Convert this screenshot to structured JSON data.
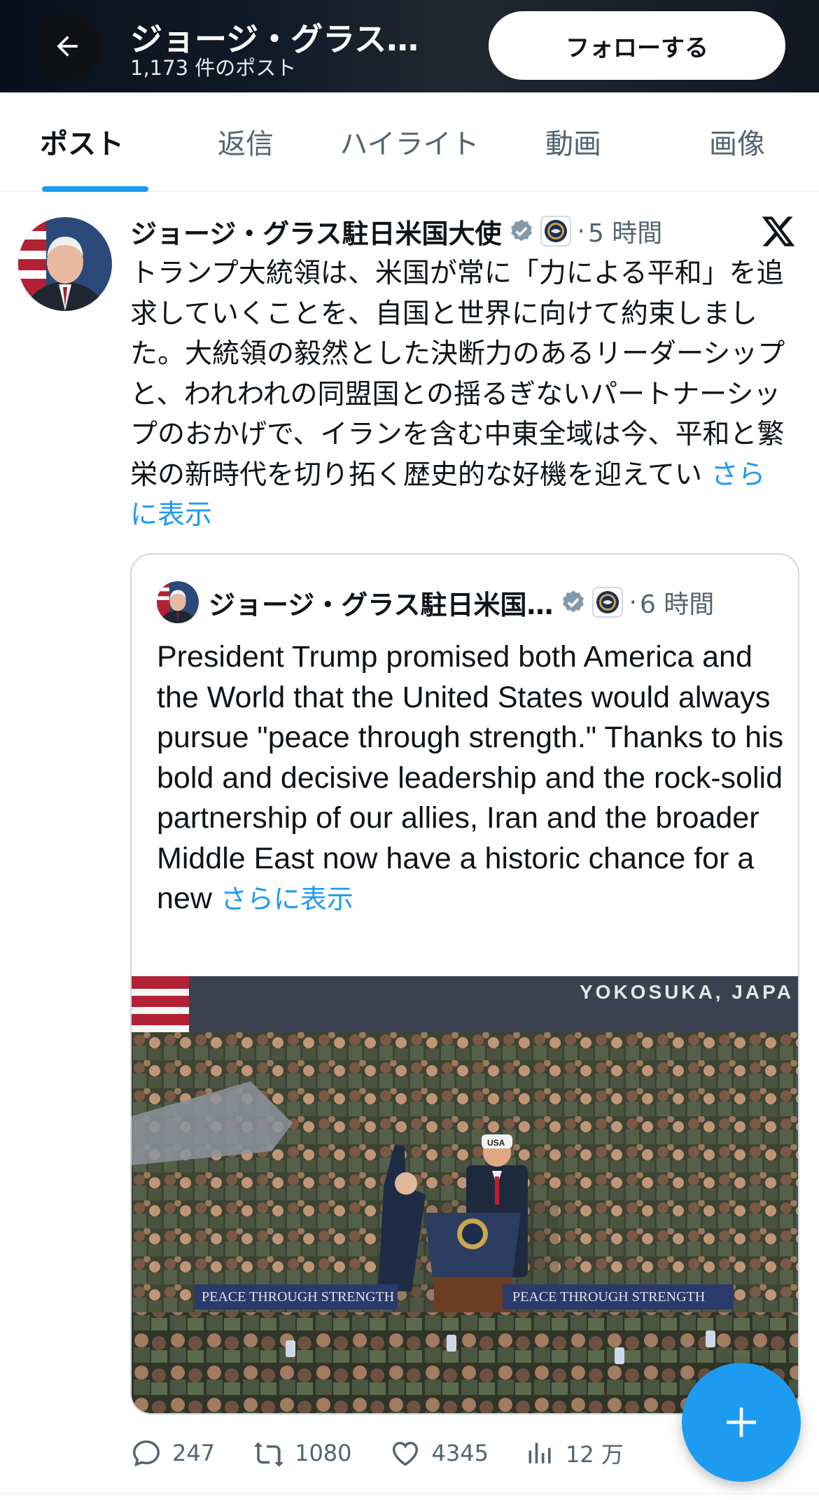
{
  "header": {
    "title": "ジョージ・グラス…",
    "post_count": "1,173 件のポスト",
    "follow_label": "フォローする"
  },
  "tabs": [
    {
      "label": "ポスト",
      "active": true
    },
    {
      "label": "返信",
      "active": false
    },
    {
      "label": "ハイライト",
      "active": false
    },
    {
      "label": "動画",
      "active": false
    },
    {
      "label": "画像",
      "active": false
    }
  ],
  "post": {
    "author_name": "ジョージ・グラス駐日米国大使",
    "separator": "·",
    "time": "5 時間",
    "text": "トランプ大統領は、米国が常に「力による平和」を追求していくことを、自国と世界に向けて約束しました。大統領の毅然とした決断力のあるリーダーシップと、われわれの同盟国との揺るぎないパートナーシップのおかげで、イランを含む中東全域は今、平和と繁栄の新時代を切り拓く歴史的な好機を迎えてい ",
    "show_more": "さらに表示"
  },
  "quote": {
    "author_name": "ジョージ・グラス駐日米国…",
    "separator": "·",
    "time": "6 時間",
    "text": "President Trump promised both America and the World that the United States would always pursue \"peace through strength.\" Thanks to his bold and decisive leadership and the rock-solid partnership of our allies, Iran and the broader Middle East now have a historic chance for a new ",
    "show_more": "さらに表示",
    "image": {
      "location_text": "YOKOSUKA, JAPA",
      "banner_left": "PEACE THROUGH STRENGTH",
      "banner_right": "PEACE THROUGH STRENGTH",
      "cap_text": "USA"
    }
  },
  "actions": {
    "replies": "247",
    "reposts": "1080",
    "likes": "4345",
    "views": "12 万"
  },
  "colors": {
    "accent": "#1d9bf0",
    "text_primary": "#0f1419",
    "text_secondary": "#536471",
    "verified": "#829aab"
  },
  "icons": [
    "back-arrow-icon",
    "verified-badge-icon",
    "government-seal-icon",
    "x-logo-icon",
    "reply-icon",
    "repost-icon",
    "like-icon",
    "views-icon",
    "plus-icon"
  ]
}
